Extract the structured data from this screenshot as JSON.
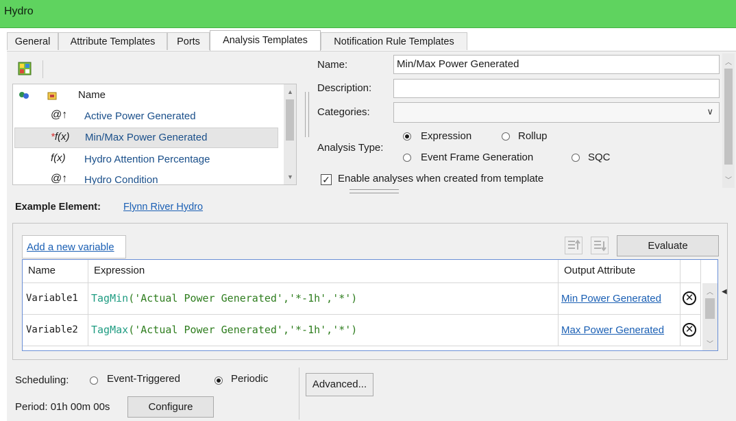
{
  "window": {
    "title": "Hydro"
  },
  "tabs": [
    "General",
    "Attribute Templates",
    "Ports",
    "Analysis Templates",
    "Notification Rule Templates"
  ],
  "list": {
    "header": "Name",
    "items": [
      "Active Power Generated",
      "Min/Max Power Generated",
      "Hydro Attention Percentage",
      "Hydro Condition"
    ]
  },
  "form": {
    "name_label": "Name:",
    "name_value": "Min/Max Power Generated",
    "description_label": "Description:",
    "description_value": "",
    "categories_label": "Categories:",
    "categories_value": "",
    "analysis_type_label": "Analysis Type:",
    "analysis_types": [
      "Expression",
      "Rollup",
      "Event Frame Generation",
      "SQC"
    ],
    "selected_analysis_type": "Expression",
    "enable_label": "Enable analyses when created from template",
    "enable_checked": true
  },
  "example": {
    "label": "Example Element:",
    "value": "Flynn River Hydro"
  },
  "variables": {
    "add_label": "Add a new variable",
    "evaluate_label": "Evaluate",
    "headers": [
      "Name",
      "Expression",
      "Output Attribute"
    ],
    "rows": [
      {
        "name": "Variable1",
        "fn": "TagMin",
        "args": "('Actual Power Generated','*-1h','*')",
        "output": "Min Power Generated"
      },
      {
        "name": "Variable2",
        "fn": "TagMax",
        "args": "('Actual Power Generated','*-1h','*')",
        "output": "Max Power Generated"
      }
    ]
  },
  "scheduling": {
    "label": "Scheduling:",
    "options": [
      "Event-Triggered",
      "Periodic"
    ],
    "selected": "Periodic",
    "period_text": "Period: 01h 00m 00s",
    "configure_label": "Configure",
    "advanced_label": "Advanced..."
  },
  "colors": {
    "titlebar": "#5fd35f",
    "link": "#1a5fb4",
    "function": "#1f9c82",
    "string": "#2e7d1e"
  }
}
